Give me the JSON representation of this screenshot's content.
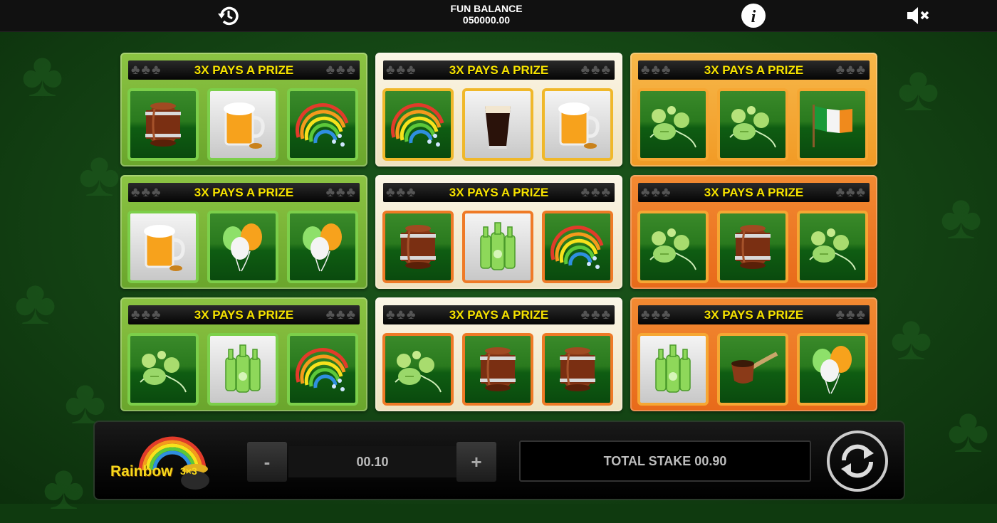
{
  "topbar": {
    "balance_label": "FUN BALANCE",
    "balance_value": "050000.00",
    "history_icon": "history-icon",
    "info_icon": "info-icon",
    "sound_icon": "mute-icon"
  },
  "tickets": [
    {
      "banner": "3X PAYS A PRIZE",
      "theme": "green",
      "symbols": [
        "barrel",
        "beer",
        "rainbow"
      ]
    },
    {
      "banner": "3X PAYS A PRIZE",
      "theme": "cream",
      "symbols": [
        "rainbow",
        "stout",
        "beer"
      ]
    },
    {
      "banner": "3X PAYS A PRIZE",
      "theme": "amber",
      "symbols": [
        "hops",
        "hops",
        "flag"
      ]
    },
    {
      "banner": "3X PAYS A PRIZE",
      "theme": "green",
      "symbols": [
        "beer",
        "balloons",
        "balloons"
      ]
    },
    {
      "banner": "3X PAYS A PRIZE",
      "theme": "cream",
      "symbols": [
        "barrel",
        "bottles",
        "rainbow"
      ]
    },
    {
      "banner": "3X PAYS A PRIZE",
      "theme": "orange",
      "symbols": [
        "hops",
        "barrel",
        "hops"
      ]
    },
    {
      "banner": "3X PAYS A PRIZE",
      "theme": "green",
      "symbols": [
        "hops",
        "bottles",
        "rainbow"
      ]
    },
    {
      "banner": "3X PAYS A PRIZE",
      "theme": "cream",
      "symbols": [
        "hops",
        "barrel",
        "barrel"
      ]
    },
    {
      "banner": "3X PAYS A PRIZE",
      "theme": "orange",
      "symbols": [
        "bottles",
        "pipe",
        "balloons"
      ]
    }
  ],
  "controls": {
    "logo_text": "Rainbow",
    "logo_suffix": "3×3",
    "minus_label": "-",
    "stake_value": "00.10",
    "plus_label": "+",
    "total_stake": "TOTAL STAKE 00.90",
    "play_icon": "spin-icon"
  },
  "colors": {
    "banner_text": "#f7e300",
    "green_ticket": "#7fb83a",
    "cream_ticket": "#f7efd8",
    "amber_ticket": "#f4a534",
    "orange_ticket": "#ee7a22"
  }
}
